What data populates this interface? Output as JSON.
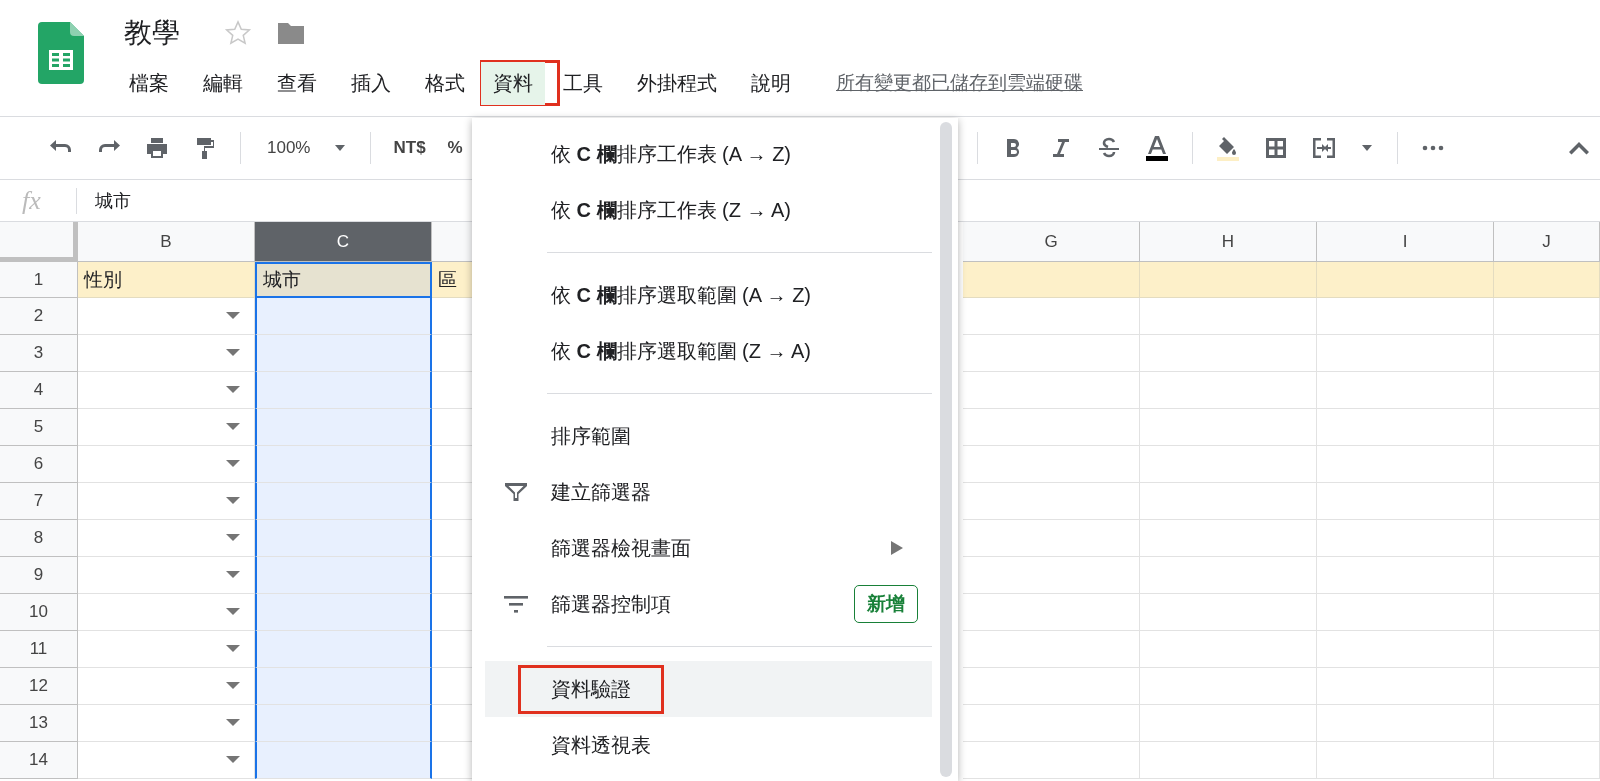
{
  "document": {
    "title": "教學",
    "starred": false
  },
  "menu_bar": [
    {
      "label": "檔案",
      "selected": false,
      "annotated": false
    },
    {
      "label": "編輯",
      "selected": false,
      "annotated": false
    },
    {
      "label": "查看",
      "selected": false,
      "annotated": false
    },
    {
      "label": "插入",
      "selected": false,
      "annotated": false
    },
    {
      "label": "格式",
      "selected": false,
      "annotated": false
    },
    {
      "label": "資料",
      "selected": true,
      "annotated": true
    },
    {
      "label": "工具",
      "selected": false,
      "annotated": false
    },
    {
      "label": "外掛程式",
      "selected": false,
      "annotated": false
    },
    {
      "label": "說明",
      "selected": false,
      "annotated": false
    }
  ],
  "save_status": "所有變更都已儲存到雲端硬碟",
  "toolbar": {
    "zoom": "100%",
    "currency": "NT$",
    "percent": "%"
  },
  "formula_bar": {
    "label": "fx",
    "value": "城市"
  },
  "grid": {
    "columns": [
      {
        "label": "B",
        "selected": false
      },
      {
        "label": "C",
        "selected": true
      },
      {
        "selected": false
      },
      {
        "kind": "covered"
      },
      {
        "kind": "covered"
      },
      {
        "label": "G",
        "selected": false
      },
      {
        "label": "H",
        "selected": false
      },
      {
        "label": "I",
        "selected": false
      },
      {
        "label": "J",
        "selected": false
      }
    ],
    "rows": [
      {
        "label": "1",
        "highlighted": true,
        "cells": [
          "性別",
          "城市",
          "區"
        ]
      },
      {
        "label": "2",
        "highlighted": false,
        "dropdown": true
      },
      {
        "label": "3",
        "highlighted": false,
        "dropdown": true
      },
      {
        "label": "4",
        "highlighted": false,
        "dropdown": true
      },
      {
        "label": "5",
        "highlighted": false,
        "dropdown": true
      },
      {
        "label": "6",
        "highlighted": false,
        "dropdown": true
      },
      {
        "label": "7",
        "highlighted": false,
        "dropdown": true
      },
      {
        "label": "8",
        "highlighted": false,
        "dropdown": true
      },
      {
        "label": "9",
        "highlighted": false,
        "dropdown": true
      },
      {
        "label": "10",
        "highlighted": false,
        "dropdown": true
      },
      {
        "label": "11",
        "highlighted": false,
        "dropdown": true
      },
      {
        "label": "12",
        "highlighted": false,
        "dropdown": true
      },
      {
        "label": "13",
        "highlighted": false,
        "dropdown": true
      },
      {
        "label": "14",
        "highlighted": false,
        "dropdown": true
      }
    ]
  },
  "data_menu": [
    {
      "kind": "item",
      "label": "依 **C 欄**排序工作表 (A → Z)",
      "hovered": false,
      "annotated": false
    },
    {
      "kind": "item",
      "label": "依 **C 欄**排序工作表 (Z → A)",
      "hovered": false,
      "annotated": false
    },
    {
      "kind": "separator"
    },
    {
      "kind": "item",
      "label": "依 **C 欄**排序選取範圍 (A → Z)",
      "hovered": false,
      "annotated": false
    },
    {
      "kind": "item",
      "label": "依 **C 欄**排序選取範圍 (Z → A)",
      "hovered": false,
      "annotated": false
    },
    {
      "kind": "separator"
    },
    {
      "kind": "item",
      "label": "排序範圍",
      "hovered": false,
      "annotated": false
    },
    {
      "kind": "filter-item",
      "label": "建立篩選器",
      "hovered": false,
      "annotated": false
    },
    {
      "kind": "item",
      "label": "篩選器檢視畫面",
      "submenu": true,
      "hovered": false,
      "annotated": false
    },
    {
      "kind": "filter-controls-item",
      "label": "篩選器控制項",
      "badge": "新增",
      "hovered": false,
      "annotated": false
    },
    {
      "kind": "separator"
    },
    {
      "kind": "item",
      "label": "資料驗證",
      "hovered": true,
      "annotated": true
    },
    {
      "kind": "item",
      "label": "資料透視表",
      "hovered": false,
      "annotated": false
    }
  ]
}
